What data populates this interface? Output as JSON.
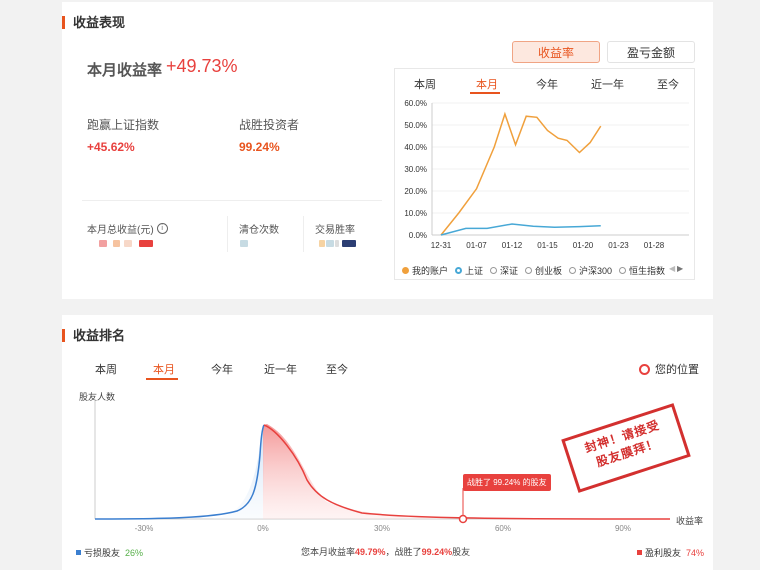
{
  "performance": {
    "title": "收益表现",
    "monthly_label": "本月收益率",
    "monthly_value": "+49.73%",
    "beat_index_label": "跑赢上证指数",
    "beat_index_value": "+45.62%",
    "beat_investors_label": "战胜投资者",
    "beat_investors_value": "99.24%",
    "total_profit_label": "本月总收益(元)",
    "clear_count_label": "清仓次数",
    "win_rate_label": "交易胜率",
    "toggle": {
      "rate": "收益率",
      "amount": "盈亏金额"
    },
    "tabs": [
      "本周",
      "本月",
      "今年",
      "近一年",
      "至今"
    ],
    "legend": [
      "我的账户",
      "上证",
      "深证",
      "创业板",
      "沪深300",
      "恒生指数"
    ],
    "colors": {
      "accent": "#e8541e",
      "account": "#f0a03c",
      "index": "#47a8d6"
    }
  },
  "chart_data": {
    "type": "line",
    "x_ticks": [
      "12-31",
      "01-07",
      "01-12",
      "01-15",
      "01-20",
      "01-23",
      "01-28"
    ],
    "y_ticks": [
      "60.0%",
      "50.0%",
      "40.0%",
      "30.0%",
      "20.0%",
      "10.0%",
      "0.0%"
    ],
    "ylim": [
      0,
      60
    ],
    "series": [
      {
        "name": "我的账户",
        "color": "#f0a03c",
        "points": [
          [
            0,
            0
          ],
          [
            0.5,
            10
          ],
          [
            1,
            21
          ],
          [
            1.5,
            40
          ],
          [
            1.8,
            55
          ],
          [
            2.1,
            41
          ],
          [
            2.4,
            54
          ],
          [
            2.7,
            53.5
          ],
          [
            3,
            47.5
          ],
          [
            3.3,
            44
          ],
          [
            3.55,
            43
          ],
          [
            3.9,
            37.5
          ],
          [
            4.2,
            42
          ],
          [
            4.5,
            49.5
          ]
        ]
      },
      {
        "name": "上证",
        "color": "#47a8d6",
        "points": [
          [
            0,
            0
          ],
          [
            0.7,
            3
          ],
          [
            1.3,
            3
          ],
          [
            2,
            5
          ],
          [
            2.6,
            4
          ],
          [
            3.2,
            3.5
          ],
          [
            3.9,
            3.8
          ],
          [
            4.5,
            4.2
          ]
        ]
      }
    ]
  },
  "ranking": {
    "title": "收益排名",
    "tabs": [
      "本周",
      "本月",
      "今年",
      "近一年",
      "至今"
    ],
    "my_position": "您的位置",
    "y_label": "股友人数",
    "x_label": "收益率",
    "x_ticks": [
      "-30%",
      "0%",
      "30%",
      "60%",
      "90%"
    ],
    "marker_text": "战胜了 99.24% 的股友",
    "loss_label": "亏损股友",
    "loss_pct": "26%",
    "profit_label": "盈利股友",
    "profit_pct": "74%",
    "summary_prefix": "您本月收益率",
    "summary_rate": "49.79%",
    "summary_mid": "，战胜了",
    "summary_pct": "99.24%",
    "summary_suffix": "股友",
    "stamp_line1": "封神！请接受",
    "stamp_line2": "股友膜拜！"
  }
}
